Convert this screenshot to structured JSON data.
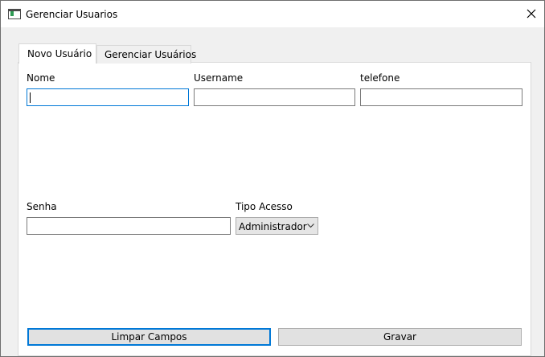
{
  "window": {
    "title": "Gerenciar Usuarios"
  },
  "icons": {
    "app": "window-app-icon",
    "close": "close-icon",
    "dropdown": "chevron-down-icon"
  },
  "tabs": [
    {
      "label": "Novo Usuário",
      "active": true
    },
    {
      "label": "Gerenciar Usuários",
      "active": false
    }
  ],
  "form": {
    "nome": {
      "label": "Nome",
      "value": ""
    },
    "username": {
      "label": "Username",
      "value": ""
    },
    "telefone": {
      "label": "telefone",
      "value": ""
    },
    "senha": {
      "label": "Senha",
      "value": ""
    },
    "tipo_acesso": {
      "label": "Tipo Acesso",
      "selected": "Administrador"
    }
  },
  "buttons": {
    "limpar": "Limpar Campos",
    "gravar": "Gravar"
  },
  "colors": {
    "focus": "#0078d7",
    "button_bg": "#e1e1e1"
  }
}
